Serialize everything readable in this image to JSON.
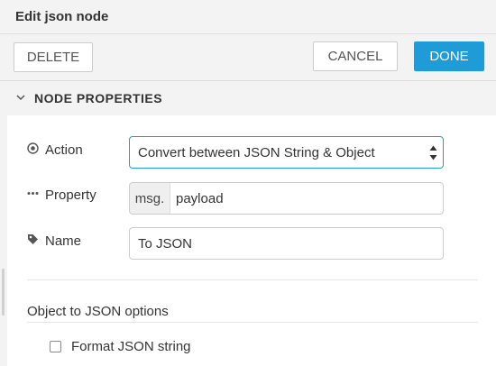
{
  "dialog": {
    "title": "Edit json node"
  },
  "toolbar": {
    "delete_label": "DELETE",
    "cancel_label": "CANCEL",
    "done_label": "DONE"
  },
  "section": {
    "title": "NODE PROPERTIES",
    "chevron_icon": "chevron-down-icon"
  },
  "fields": {
    "action": {
      "label": "Action",
      "icon": "radio-target-icon",
      "selected": "Convert between JSON String & Object"
    },
    "property": {
      "label": "Property",
      "icon": "ellipsis-icon",
      "prefix": "msg.",
      "value": "payload"
    },
    "name": {
      "label": "Name",
      "icon": "tag-icon",
      "value": "To JSON"
    }
  },
  "options": {
    "heading": "Object to JSON options",
    "format_label": "Format JSON string",
    "format_checked": false
  },
  "colors": {
    "accent": "#1f9bd8",
    "panel_bg": "#f3f3f3"
  }
}
